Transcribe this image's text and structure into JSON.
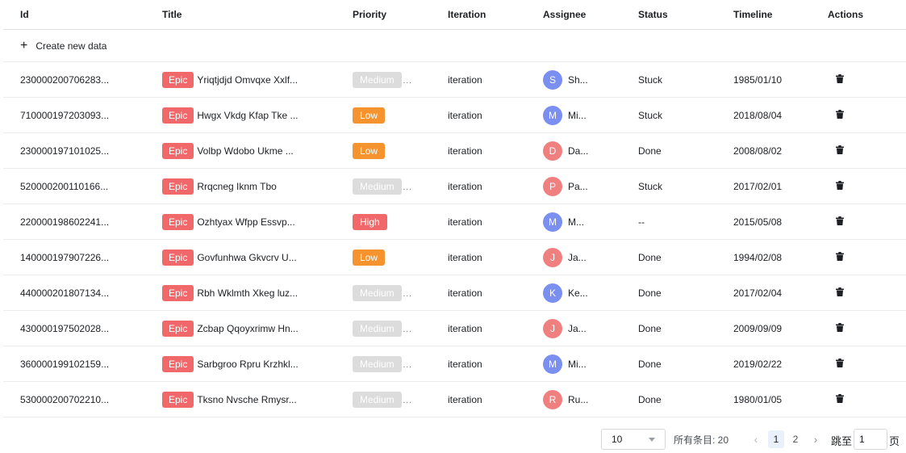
{
  "columns": {
    "id": "Id",
    "title": "Title",
    "priority": "Priority",
    "iteration": "Iteration",
    "assignee": "Assignee",
    "status": "Status",
    "timeline": "Timeline",
    "actions": "Actions"
  },
  "create_label": "Create new data",
  "icons": {
    "create": "plus-icon",
    "delete": "trash-icon",
    "prev": "chevron-left-icon",
    "next": "chevron-right-icon",
    "dropdown": "caret-down-icon"
  },
  "colors": {
    "epic": "#f0686a",
    "priority_high": "#f0686a",
    "priority_low": "#f5932e",
    "priority_medium": "#dcdcdc",
    "avatar_blue": "#7b8ff0",
    "avatar_red": "#f08080"
  },
  "rows": [
    {
      "id": "230000200706283...",
      "type": "Epic",
      "title": "Yriqtjdjd Omvqxe Xxlf...",
      "priority": "Medium",
      "iteration": "iteration",
      "assignee_initial": "S",
      "assignee_name": "Sh...",
      "avatar_color": "#7b8ff0",
      "status": "Stuck",
      "timeline": "1985/01/10"
    },
    {
      "id": "710000197203093...",
      "type": "Epic",
      "title": "Hwgx Vkdg Kfap Tke ...",
      "priority": "Low",
      "iteration": "iteration",
      "assignee_initial": "M",
      "assignee_name": "Mi...",
      "avatar_color": "#7b8ff0",
      "status": "Stuck",
      "timeline": "2018/08/04"
    },
    {
      "id": "230000197101025...",
      "type": "Epic",
      "title": "Volbp Wdobo Ukme ...",
      "priority": "Low",
      "iteration": "iteration",
      "assignee_initial": "D",
      "assignee_name": "Da...",
      "avatar_color": "#f08080",
      "status": "Done",
      "timeline": "2008/08/02"
    },
    {
      "id": "520000200110166...",
      "type": "Epic",
      "title": "Rrqcneg Iknm Tbo",
      "priority": "Medium",
      "iteration": "iteration",
      "assignee_initial": "P",
      "assignee_name": "Pa...",
      "avatar_color": "#f08080",
      "status": "Stuck",
      "timeline": "2017/02/01"
    },
    {
      "id": "220000198602241...",
      "type": "Epic",
      "title": "Ozhtyax Wfpp Essvp...",
      "priority": "High",
      "iteration": "iteration",
      "assignee_initial": "M",
      "assignee_name": "M...",
      "avatar_color": "#7b8ff0",
      "status": "--",
      "timeline": "2015/05/08"
    },
    {
      "id": "140000197907226...",
      "type": "Epic",
      "title": "Govfunhwa Gkvcrv U...",
      "priority": "Low",
      "iteration": "iteration",
      "assignee_initial": "J",
      "assignee_name": "Ja...",
      "avatar_color": "#f08080",
      "status": "Done",
      "timeline": "1994/02/08"
    },
    {
      "id": "440000201807134...",
      "type": "Epic",
      "title": "Rbh Wklmth Xkeg luz...",
      "priority": "Medium",
      "iteration": "iteration",
      "assignee_initial": "K",
      "assignee_name": "Ke...",
      "avatar_color": "#7b8ff0",
      "status": "Done",
      "timeline": "2017/02/04"
    },
    {
      "id": "430000197502028...",
      "type": "Epic",
      "title": "Zcbap Qqoyxrimw Hn...",
      "priority": "Medium",
      "iteration": "iteration",
      "assignee_initial": "J",
      "assignee_name": "Ja...",
      "avatar_color": "#f08080",
      "status": "Done",
      "timeline": "2009/09/09"
    },
    {
      "id": "360000199102159...",
      "type": "Epic",
      "title": "Sarbgroo Rpru Krzhkl...",
      "priority": "Medium",
      "iteration": "iteration",
      "assignee_initial": "M",
      "assignee_name": "Mi...",
      "avatar_color": "#7b8ff0",
      "status": "Done",
      "timeline": "2019/02/22"
    },
    {
      "id": "530000200702210...",
      "type": "Epic",
      "title": "Tksno Nvsche Rmysr...",
      "priority": "Medium",
      "iteration": "iteration",
      "assignee_initial": "R",
      "assignee_name": "Ru...",
      "avatar_color": "#f08080",
      "status": "Done",
      "timeline": "1980/01/05"
    }
  ],
  "pagination": {
    "page_size": "10",
    "total": "所有条目: 20",
    "prev": "‹",
    "next": "›",
    "pages": [
      "1",
      "2"
    ],
    "current_page": "1",
    "jump_label": "跳至",
    "jump_value": "1",
    "page_suffix": "页"
  }
}
